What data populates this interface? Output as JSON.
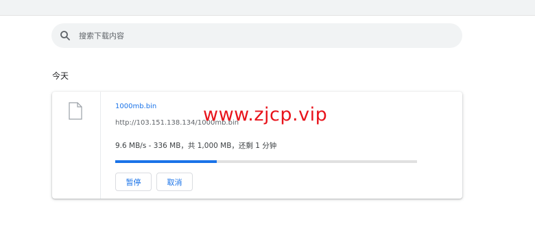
{
  "search": {
    "placeholder": "搜索下载内容",
    "icon": "search-icon"
  },
  "date_group": "今天",
  "download": {
    "file_name": "1000mb.bin",
    "url": "http://103.151.138.134/1000mb.bin",
    "status": "9.6 MB/s - 336 MB，共 1,000 MB，还剩 1 分钟",
    "progress_fraction": 0.336,
    "file_icon": "file-icon",
    "pause_label": "暂停",
    "cancel_label": "取消"
  },
  "watermark": "www.zjcp.vip",
  "colors": {
    "accent": "#1a73e8",
    "watermark": "#e8131b",
    "progress_track": "#e0e0e0"
  }
}
